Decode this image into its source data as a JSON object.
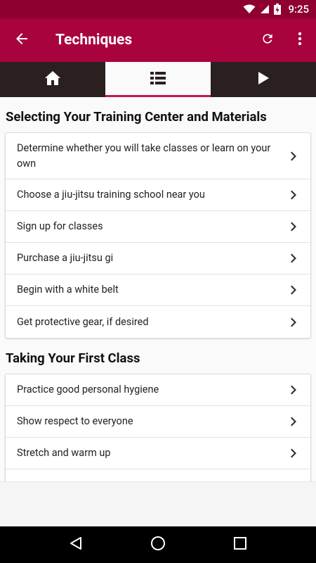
{
  "status_bar": {
    "time": "9:25"
  },
  "app_bar": {
    "title": "Techniques"
  },
  "sections": [
    {
      "title": "Selecting Your Training Center and Materials",
      "items": [
        "Determine whether you will take classes or learn on your own",
        "Choose a jiu-jitsu training school near you",
        "Sign up for classes",
        "Purchase a jiu-jitsu gi",
        "Begin with a white belt",
        "Get protective gear, if desired"
      ]
    },
    {
      "title": "Taking Your First Class",
      "items": [
        "Practice good personal hygiene",
        "Show respect to everyone",
        "Stretch and warm up"
      ]
    }
  ],
  "colors": {
    "status_bar": "#8d0030",
    "app_bar": "#a8023f",
    "tab_bar": "#2b2020",
    "tab_indicator": "#c2185b"
  }
}
